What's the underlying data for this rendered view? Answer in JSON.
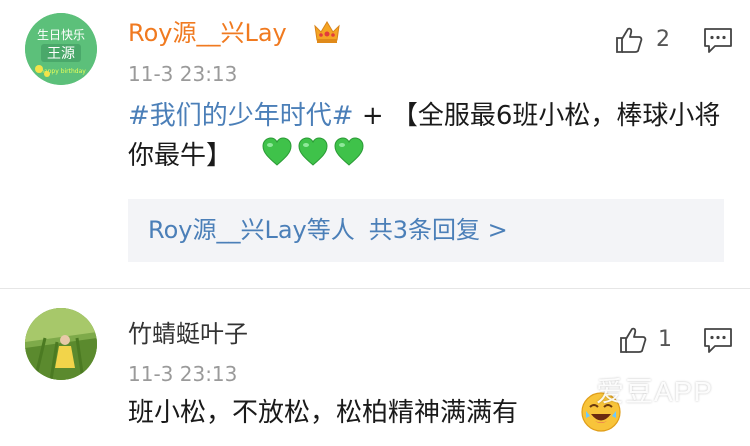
{
  "comments": [
    {
      "avatar_text": [
        "生日快乐",
        "王源",
        "happy birthday"
      ],
      "username": "Roy源__兴Lay",
      "badge_icon": "crown-icon",
      "time": "11-3 23:13",
      "likes": "2",
      "body_hashtag": "#我们的少年时代#",
      "body_text": " + 【全服最6班小松，棒球小将你最牛】",
      "emoji": [
        "green-heart",
        "green-heart",
        "green-heart"
      ],
      "reply_summary": {
        "users": "Roy源__兴Lay",
        "suffix": "等人",
        "count_text": "共3条回复 >"
      }
    },
    {
      "username": "竹蜻蜓叶子",
      "time": "11-3 23:13",
      "likes": "1",
      "body_text": "班小松，不放松，松柏精神满满有",
      "emoji": [
        "laughing-face"
      ]
    }
  ],
  "watermark": "爱豆APP",
  "colors": {
    "username_vip": "#f07a20",
    "hashtag": "#4b7fb8",
    "timestamp": "#9a9a9a",
    "heart": "#3fc24a"
  }
}
